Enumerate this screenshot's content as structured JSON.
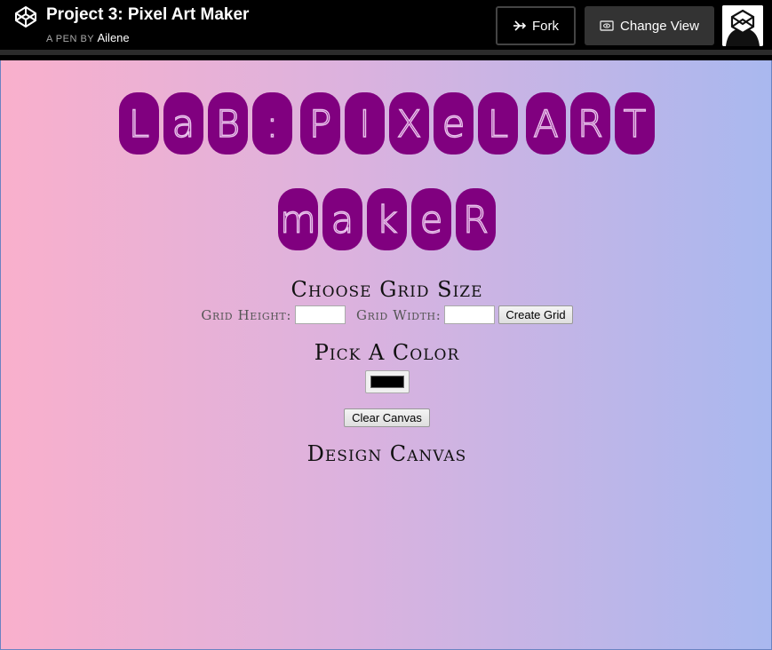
{
  "header": {
    "title": "Project 3: Pixel Art Maker",
    "byline_prefix": "A PEN BY",
    "author": "Ailene",
    "fork_label": "Fork",
    "change_view_label": "Change View"
  },
  "page": {
    "headline_rows": [
      [
        [
          "L",
          "a",
          "B",
          ":"
        ],
        [
          "P",
          "I",
          "X",
          "e",
          "L"
        ],
        [
          "A",
          "R",
          "T"
        ]
      ],
      [
        [
          "m",
          "a",
          "k",
          "e",
          "R"
        ]
      ]
    ],
    "grid_heading": "Choose Grid Size",
    "grid_height_label": "Grid Height:",
    "grid_height_value": "",
    "grid_width_label": "Grid Width:",
    "grid_width_value": "",
    "create_grid_label": "Create Grid",
    "color_heading": "Pick A Color",
    "color_value": "#000000",
    "clear_canvas_label": "Clear Canvas",
    "canvas_heading": "Design Canvas"
  },
  "colors": {
    "tile": "#80007f",
    "gradient_left": "#f9b0cc",
    "gradient_right": "#a9b8ef"
  }
}
